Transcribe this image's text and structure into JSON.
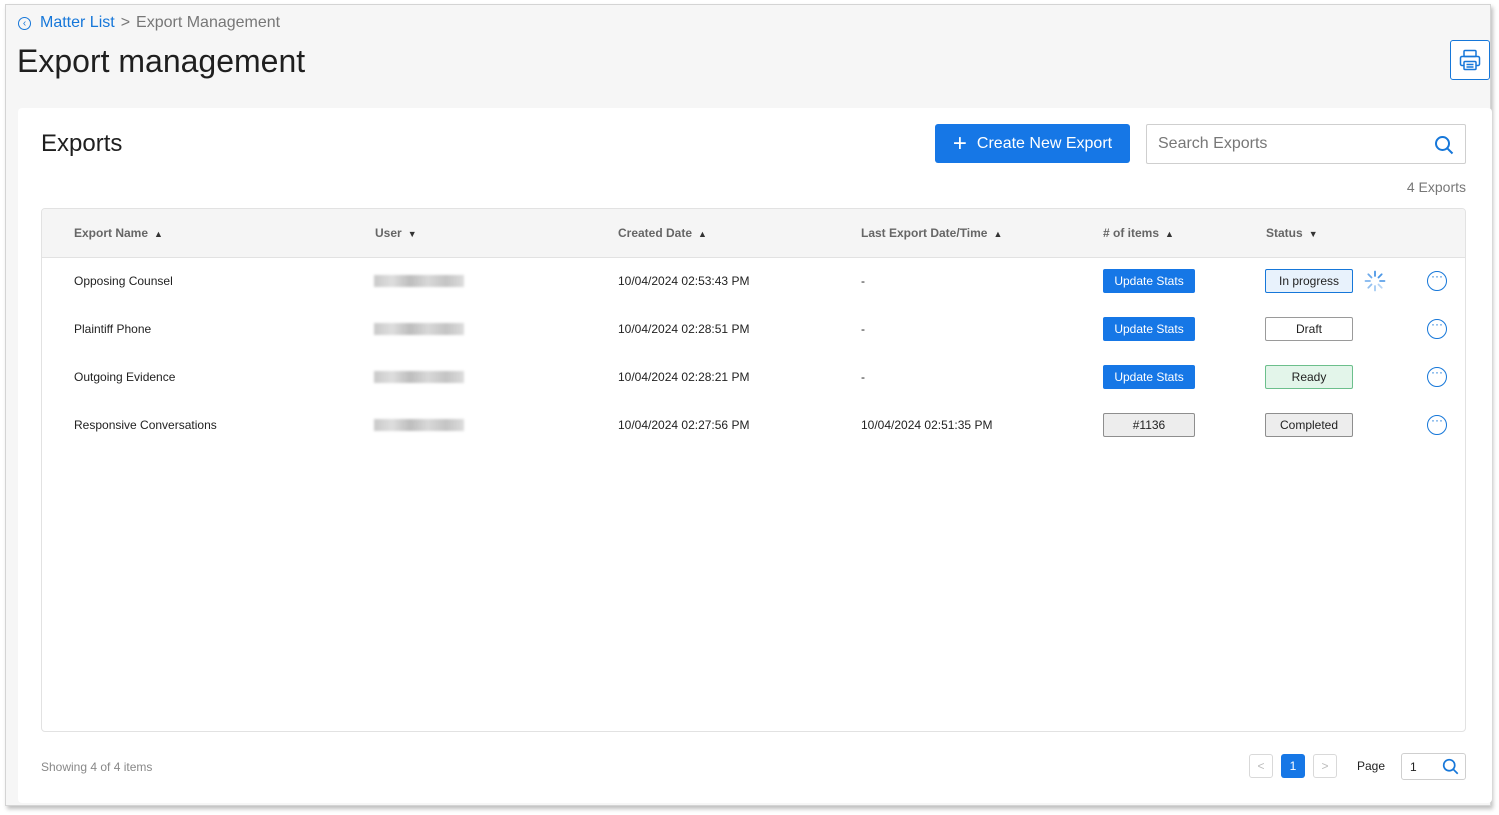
{
  "breadcrumb": {
    "link": "Matter List",
    "separator": ">",
    "current": "Export Management"
  },
  "page_title": "Export management",
  "card": {
    "title": "Exports",
    "create_button": "Create New Export",
    "search_placeholder": "Search Exports",
    "count_text": "4 Exports"
  },
  "columns": [
    {
      "label": "Export Name",
      "arrow": "▲"
    },
    {
      "label": "User",
      "arrow": "▼"
    },
    {
      "label": "Created Date",
      "arrow": "▲"
    },
    {
      "label": "Last Export Date/Time",
      "arrow": "▲"
    },
    {
      "label": "# of items",
      "arrow": "▲"
    },
    {
      "label": "Status",
      "arrow": "▼"
    }
  ],
  "rows": [
    {
      "name": "Opposing Counsel",
      "created": "10/04/2024 02:53:43 PM",
      "last_export": "-",
      "items": "Update Stats",
      "status": "In progress"
    },
    {
      "name": "Plaintiff Phone",
      "created": "10/04/2024 02:28:51 PM",
      "last_export": "-",
      "items": "Update Stats",
      "status": "Draft"
    },
    {
      "name": "Outgoing Evidence",
      "created": "10/04/2024 02:28:21 PM",
      "last_export": "-",
      "items": "Update Stats",
      "status": "Ready"
    },
    {
      "name": "Responsive Conversations",
      "created": "10/04/2024 02:27:56 PM",
      "last_export": "10/04/2024 02:51:35 PM",
      "items": "#1136",
      "status": "Completed"
    }
  ],
  "status_colors": {
    "in_progress": {
      "bg": "#e8f2fc",
      "border": "#1677d9"
    },
    "draft": {
      "bg": "#ffffff",
      "border": "#9a9a9a"
    },
    "ready": {
      "bg": "#e3f5ea",
      "border": "#6cbf8c"
    },
    "completed": {
      "bg": "#ededed",
      "border": "#8e8e8e"
    }
  },
  "accent_color": "#1677e6",
  "footer": {
    "showing": "Showing 4 of 4 items",
    "prev": "<",
    "current_page": "1",
    "next": ">",
    "page_label": "Page",
    "page_input_value": "1"
  },
  "icons": {
    "back": "chevron-left-circle-icon",
    "print": "printer-icon",
    "search": "search-icon",
    "spinner": "loading-spinner-icon",
    "more": "ellipsis-circle-icon"
  }
}
